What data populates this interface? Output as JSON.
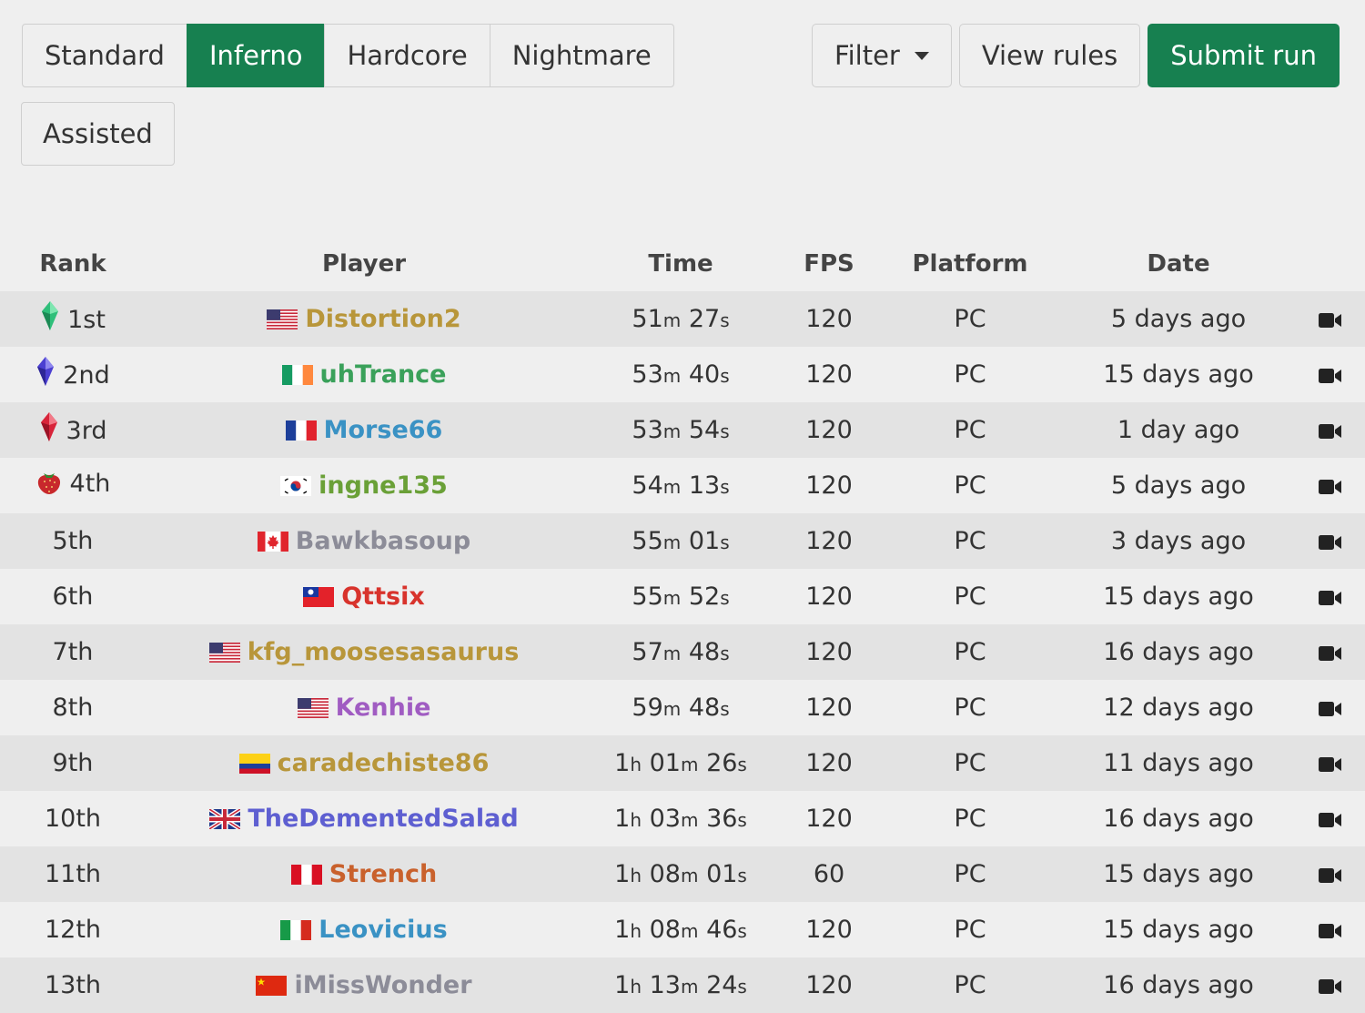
{
  "categories": {
    "tabs": [
      {
        "label": "Standard",
        "active": false
      },
      {
        "label": "Inferno",
        "active": true
      },
      {
        "label": "Hardcore",
        "active": false
      },
      {
        "label": "Nightmare",
        "active": false
      }
    ],
    "second_row": {
      "label": "Assisted"
    }
  },
  "actions": {
    "filter_label": "Filter",
    "rules_label": "View rules",
    "submit_label": "Submit run"
  },
  "table": {
    "headers": {
      "rank": "Rank",
      "player": "Player",
      "time": "Time",
      "fps": "FPS",
      "platform": "Platform",
      "date": "Date"
    },
    "rows": [
      {
        "rank": "1st",
        "rank_icon": "green-gem-icon",
        "flag": "us",
        "player": "Distortion2",
        "color": "#b8963a",
        "h": "",
        "m": "51",
        "s": "27",
        "fps": "120",
        "platform": "PC",
        "date": "5 days ago"
      },
      {
        "rank": "2nd",
        "rank_icon": "blue-gem-icon",
        "flag": "ie",
        "player": "uhTrance",
        "color": "#3aa15a",
        "h": "",
        "m": "53",
        "s": "40",
        "fps": "120",
        "platform": "PC",
        "date": "15 days ago"
      },
      {
        "rank": "3rd",
        "rank_icon": "red-gem-icon",
        "flag": "fr",
        "player": "Morse66",
        "color": "#3a92c4",
        "h": "",
        "m": "53",
        "s": "54",
        "fps": "120",
        "platform": "PC",
        "date": "1 day ago"
      },
      {
        "rank": "4th",
        "rank_icon": "strawberry-icon",
        "flag": "kr",
        "player": "ingne135",
        "color": "#6aa037",
        "h": "",
        "m": "54",
        "s": "13",
        "fps": "120",
        "platform": "PC",
        "date": "5 days ago"
      },
      {
        "rank": "5th",
        "rank_icon": "",
        "flag": "ca",
        "player": "Bawkbasoup",
        "color": "#8c8c98",
        "h": "",
        "m": "55",
        "s": "01",
        "fps": "120",
        "platform": "PC",
        "date": "3 days ago"
      },
      {
        "rank": "6th",
        "rank_icon": "",
        "flag": "tw",
        "player": "Qttsix",
        "color": "#d8332c",
        "h": "",
        "m": "55",
        "s": "52",
        "fps": "120",
        "platform": "PC",
        "date": "15 days ago"
      },
      {
        "rank": "7th",
        "rank_icon": "",
        "flag": "us",
        "player": "kfg_moosesasaurus",
        "color": "#b8963a",
        "h": "",
        "m": "57",
        "s": "48",
        "fps": "120",
        "platform": "PC",
        "date": "16 days ago"
      },
      {
        "rank": "8th",
        "rank_icon": "",
        "flag": "us",
        "player": "Kenhie",
        "color": "#a05cc2",
        "h": "",
        "m": "59",
        "s": "48",
        "fps": "120",
        "platform": "PC",
        "date": "12 days ago"
      },
      {
        "rank": "9th",
        "rank_icon": "",
        "flag": "co",
        "player": "caradechiste86",
        "color": "#b8963a",
        "h": "1",
        "m": "01",
        "s": "26",
        "fps": "120",
        "platform": "PC",
        "date": "11 days ago"
      },
      {
        "rank": "10th",
        "rank_icon": "",
        "flag": "gb",
        "player": "TheDementedSalad",
        "color": "#5e5fd1",
        "h": "1",
        "m": "03",
        "s": "36",
        "fps": "120",
        "platform": "PC",
        "date": "16 days ago"
      },
      {
        "rank": "11th",
        "rank_icon": "",
        "flag": "pe",
        "player": "Strench",
        "color": "#c9612c",
        "h": "1",
        "m": "08",
        "s": "01",
        "fps": "60",
        "platform": "PC",
        "date": "15 days ago"
      },
      {
        "rank": "12th",
        "rank_icon": "",
        "flag": "it",
        "player": "Leovicius",
        "color": "#3a92c4",
        "h": "1",
        "m": "08",
        "s": "46",
        "fps": "120",
        "platform": "PC",
        "date": "15 days ago"
      },
      {
        "rank": "13th",
        "rank_icon": "",
        "flag": "cn",
        "player": "iMissWonder",
        "color": "#8c8c98",
        "h": "1",
        "m": "13",
        "s": "24",
        "fps": "120",
        "platform": "PC",
        "date": "16 days ago"
      }
    ]
  },
  "units": {
    "h": "h",
    "m": "m",
    "s": "s"
  },
  "colors": {
    "accent": "#178050",
    "row_odd": "#e3e3e3",
    "row_even": "#efefef"
  },
  "icons": {
    "video": "video-camera-icon",
    "filter_caret": "caret-down-icon"
  }
}
